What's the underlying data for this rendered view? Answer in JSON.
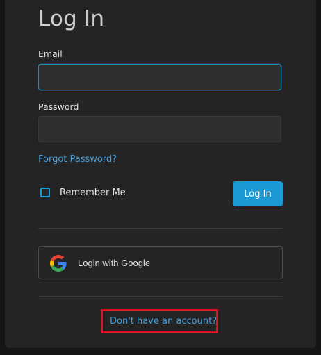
{
  "form": {
    "title": "Log In",
    "email_label": "Email",
    "email_value": "",
    "password_label": "Password",
    "password_value": "",
    "forgot_password": "Forgot Password?",
    "remember_me": "Remember Me",
    "remember_checked": false,
    "login_button": "Log In",
    "google_button": "Login with Google",
    "signup_link": "Don't have an account?"
  },
  "colors": {
    "accent": "#1d9ad4",
    "link": "#3e9fe0",
    "background": "#242424",
    "highlight": "#e0121b"
  },
  "icons": {
    "google": "google-g-icon"
  }
}
